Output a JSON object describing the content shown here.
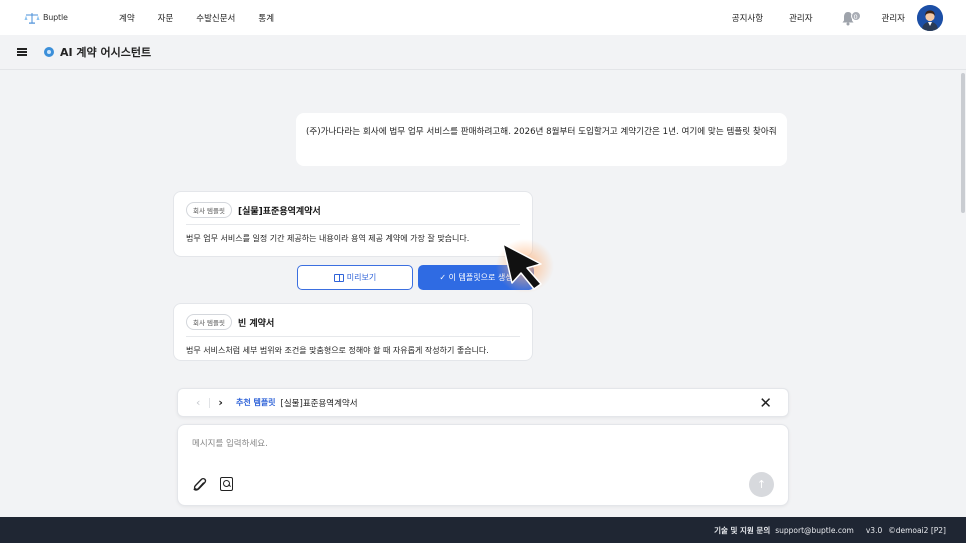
{
  "nav": {
    "logo_text": "Buptle",
    "menu": [
      "계약",
      "자문",
      "수발신문서",
      "통계"
    ],
    "notice": "공지사항",
    "admin_link": "관리자",
    "bell_count": "0",
    "user_name": "관리자"
  },
  "subheader": {
    "title": "AI 계약 어시스턴트"
  },
  "chat": {
    "user_message": "(주)가나다라는 회사에 법무 업무 서비스를 판매하려고해. 2026년 8월부터 도입할거고 계약기간은 1년.  여기에 맞는 템플릿 찾아줘",
    "cards": [
      {
        "chip": "회사 템플릿",
        "title": "[실물]표준용역계약서",
        "desc": "법무 업무 서비스를 일정 기간 제공하는 내용이라 용역 제공 계약에 가장 잘 맞습니다."
      },
      {
        "chip": "회사 템플릿",
        "title": "빈 계약서",
        "desc": "법무 서비스처럼 세부 범위와 조건을 맞춤형으로 정해야 할 때 자유롭게 작성하기 좋습니다."
      }
    ],
    "preview_label": "미리보기",
    "create_label": "✓  이 템플릿으로 생성"
  },
  "recommendation": {
    "prev": "‹",
    "next": "›",
    "label": "추천 템플릿",
    "name": "[실물]표준용역계약서",
    "close": "✕"
  },
  "composer": {
    "placeholder": "메시지를 입력하세요.",
    "send": "↑"
  },
  "footer": {
    "label": "기술 및 지원 문의",
    "email": "support@buptle.com",
    "version": "v3.0",
    "copyright": "©demoai2 [P2]"
  }
}
